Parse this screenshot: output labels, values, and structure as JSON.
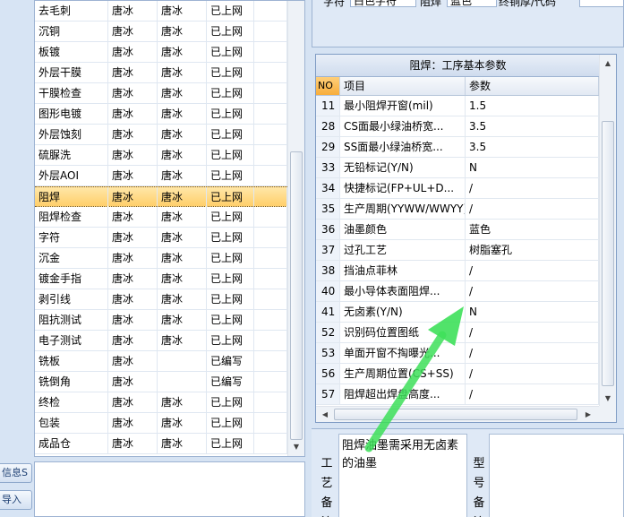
{
  "process_list": {
    "rows": [
      {
        "name": "去毛刺",
        "person1": "唐冰",
        "person2": "唐冰",
        "status": "已上网",
        "selected": false
      },
      {
        "name": "沉铜",
        "person1": "唐冰",
        "person2": "唐冰",
        "status": "已上网",
        "selected": false
      },
      {
        "name": "板镀",
        "person1": "唐冰",
        "person2": "唐冰",
        "status": "已上网",
        "selected": false
      },
      {
        "name": "外层干膜",
        "person1": "唐冰",
        "person2": "唐冰",
        "status": "已上网",
        "selected": false
      },
      {
        "name": "干膜检查",
        "person1": "唐冰",
        "person2": "唐冰",
        "status": "已上网",
        "selected": false
      },
      {
        "name": "图形电镀",
        "person1": "唐冰",
        "person2": "唐冰",
        "status": "已上网",
        "selected": false
      },
      {
        "name": "外层蚀刻",
        "person1": "唐冰",
        "person2": "唐冰",
        "status": "已上网",
        "selected": false
      },
      {
        "name": "硫脲洗",
        "person1": "唐冰",
        "person2": "唐冰",
        "status": "已上网",
        "selected": false
      },
      {
        "name": "外层AOI",
        "person1": "唐冰",
        "person2": "唐冰",
        "status": "已上网",
        "selected": false
      },
      {
        "name": "阻焊",
        "person1": "唐冰",
        "person2": "唐冰",
        "status": "已上网",
        "selected": true
      },
      {
        "name": "阻焊检查",
        "person1": "唐冰",
        "person2": "唐冰",
        "status": "已上网",
        "selected": false
      },
      {
        "name": "字符",
        "person1": "唐冰",
        "person2": "唐冰",
        "status": "已上网",
        "selected": false
      },
      {
        "name": "沉金",
        "person1": "唐冰",
        "person2": "唐冰",
        "status": "已上网",
        "selected": false
      },
      {
        "name": "镀金手指",
        "person1": "唐冰",
        "person2": "唐冰",
        "status": "已上网",
        "selected": false
      },
      {
        "name": "剥引线",
        "person1": "唐冰",
        "person2": "唐冰",
        "status": "已上网",
        "selected": false
      },
      {
        "name": "阻抗测试",
        "person1": "唐冰",
        "person2": "唐冰",
        "status": "已上网",
        "selected": false
      },
      {
        "name": "电子测试",
        "person1": "唐冰",
        "person2": "唐冰",
        "status": "已上网",
        "selected": false
      },
      {
        "name": "铣板",
        "person1": "唐冰",
        "person2": "",
        "status": "已编写",
        "selected": false
      },
      {
        "name": "铣倒角",
        "person1": "唐冰",
        "person2": "",
        "status": "已编写",
        "selected": false
      },
      {
        "name": "终检",
        "person1": "唐冰",
        "person2": "唐冰",
        "status": "已上网",
        "selected": false
      },
      {
        "name": "包装",
        "person1": "唐冰",
        "person2": "唐冰",
        "status": "已上网",
        "selected": false
      },
      {
        "name": "成品仓",
        "person1": "唐冰",
        "person2": "唐冰",
        "status": "已上网",
        "selected": false
      }
    ]
  },
  "side_buttons": {
    "btn1": "信息S",
    "btn2": "导入"
  },
  "top_panel": {
    "label1": "字符",
    "field1": "白色字符",
    "label2": "阻焊",
    "field2": "蓝色",
    "label3": "终铜厚/代码"
  },
  "param_grid": {
    "caption": "阻焊：工序基本参数",
    "headers": {
      "no": "NO",
      "item": "项目",
      "value": "参数"
    },
    "rows": [
      {
        "no": "11",
        "item": "最小阻焊开窗(mil)",
        "value": "1.5"
      },
      {
        "no": "28",
        "item": "CS面最小绿油桥宽...",
        "value": "3.5"
      },
      {
        "no": "29",
        "item": "SS面最小绿油桥宽...",
        "value": "3.5"
      },
      {
        "no": "33",
        "item": "无铅标记(Y/N)",
        "value": "N"
      },
      {
        "no": "34",
        "item": "快捷标记(FP+UL+D...",
        "value": "/"
      },
      {
        "no": "35",
        "item": "生产周期(YYWW/WWYY)",
        "value": "/"
      },
      {
        "no": "36",
        "item": "油墨颜色",
        "value": "蓝色"
      },
      {
        "no": "37",
        "item": "过孔工艺",
        "value": "树脂塞孔"
      },
      {
        "no": "38",
        "item": "挡油点菲林",
        "value": "/"
      },
      {
        "no": "40",
        "item": "最小导体表面阻焊...",
        "value": "/"
      },
      {
        "no": "41",
        "item": "无卤素(Y/N)",
        "value": "N"
      },
      {
        "no": "52",
        "item": "识别码位置图纸",
        "value": "/"
      },
      {
        "no": "53",
        "item": "单面开窗不掏曝光...",
        "value": "/"
      },
      {
        "no": "56",
        "item": "生产周期位置(CS+SS)",
        "value": "/"
      },
      {
        "no": "57",
        "item": "阻焊超出焊盘高度...",
        "value": "/"
      }
    ]
  },
  "process_note": {
    "label": "工艺备注",
    "text": "阻焊油墨需采用无卤素的油墨"
  },
  "model_note": {
    "label": "型号备注",
    "text": ""
  },
  "colors": {
    "selection": "#ffcf6a",
    "arrow": "#3ee05a",
    "panel_bg": "#d6e3f3"
  }
}
